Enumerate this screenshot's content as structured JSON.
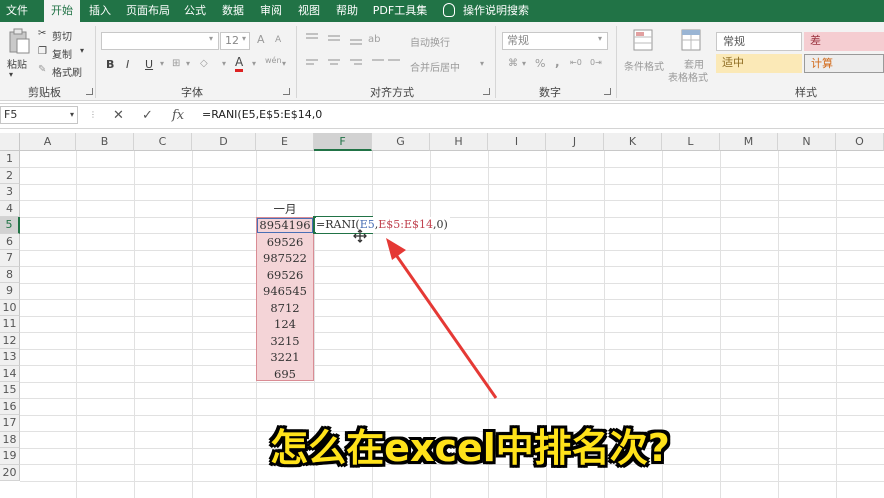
{
  "menu": {
    "tabs": [
      "文件",
      "开始",
      "插入",
      "页面布局",
      "公式",
      "数据",
      "审阅",
      "视图",
      "帮助",
      "PDF工具集"
    ],
    "active_tab": "开始",
    "tell_me": "操作说明搜索"
  },
  "ribbon": {
    "clipboard": {
      "paste": "粘贴",
      "cut": "剪切",
      "copy": "复制",
      "format_painter": "格式刷",
      "label": "剪贴板"
    },
    "font": {
      "size": "12",
      "bold": "B",
      "italic": "I",
      "underline": "U",
      "label": "字体",
      "grow": "A",
      "shrink": "A",
      "color": "A",
      "pinyin": "wén"
    },
    "alignment": {
      "wrap": "自动换行",
      "merge": "合并后居中",
      "label": "对齐方式"
    },
    "number": {
      "format": "常规",
      "percent": "%",
      "comma": ",",
      "label": "数字"
    },
    "styles": {
      "conditional": "条件格式",
      "table_1": "套用",
      "table_2": "表格格式",
      "normal": "常规",
      "bad": "差",
      "neutral": "适中",
      "calc": "计算",
      "label": "样式"
    }
  },
  "formula_bar": {
    "name_box": "F5",
    "cancel": "✕",
    "enter": "✓",
    "fx": "fx",
    "formula": "=RANI(E5,E$5:E$14,0"
  },
  "sheet": {
    "columns": [
      "A",
      "B",
      "C",
      "D",
      "E",
      "F",
      "G",
      "H",
      "I",
      "J",
      "K",
      "L",
      "M",
      "N",
      "O"
    ],
    "rows": [
      "1",
      "2",
      "3",
      "4",
      "5",
      "6",
      "7",
      "8",
      "9",
      "10",
      "11",
      "12",
      "13",
      "14",
      "15",
      "16",
      "17",
      "18",
      "19",
      "20"
    ],
    "selected_column": "F",
    "selected_row": "5",
    "header_e4": "一月",
    "values_e": [
      "8954196",
      "69526",
      "987522",
      "69526",
      "946545",
      "8712",
      "124",
      "3215",
      "3221",
      "695"
    ],
    "edit": {
      "func": "=RANI(",
      "arg1": "E5",
      "comma1": ",",
      "arg2": "E$5:E$14",
      "rest": ",0)"
    }
  },
  "colors": {
    "green": "#217346",
    "range_fill": "#f4d4d7",
    "range_border": "#d98c94",
    "arrow": "#e53935",
    "arg1": "#4a6fb5",
    "arg2": "#c0424f"
  },
  "caption": "怎么在excel中排名次?"
}
